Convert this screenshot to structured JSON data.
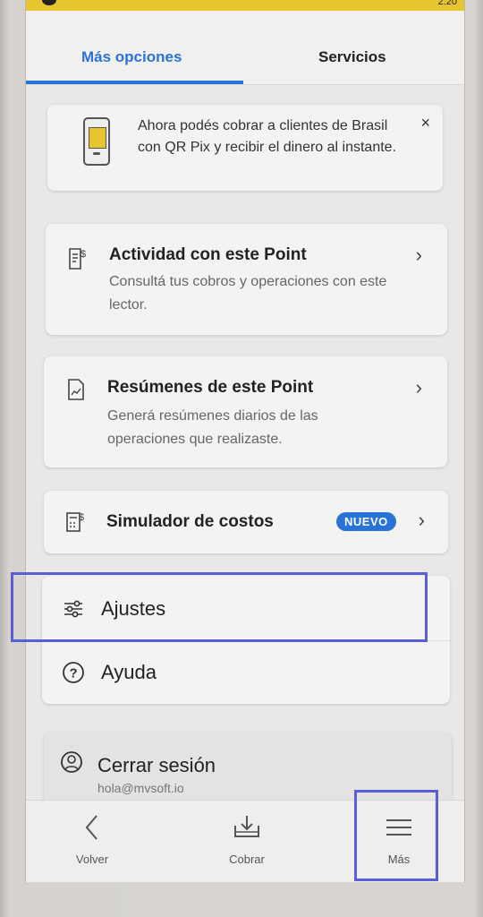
{
  "status_bar": {
    "time": "2:20"
  },
  "tabs": [
    {
      "label": "Más opciones",
      "active": true
    },
    {
      "label": "Servicios",
      "active": false
    }
  ],
  "banner": {
    "text": "Ahora podés cobrar a clientes de Brasil con QR Pix y recibir el dinero al instante.",
    "close": "×",
    "icon": "card-reader-icon"
  },
  "items": [
    {
      "title": "Actividad con este Point",
      "description": "Consultá tus cobros y operaciones con este lector.",
      "icon": "receipt-dollar-icon"
    },
    {
      "title": "Resúmenes de este Point",
      "description": "Generá resúmenes diarios de las operaciones que realizaste.",
      "icon": "document-chart-icon"
    },
    {
      "title": "Simulador de costos",
      "badge": "NUEVO",
      "icon": "calculator-dollar-icon"
    }
  ],
  "settings_group": [
    {
      "label": "Ajustes",
      "icon": "sliders-icon"
    },
    {
      "label": "Ayuda",
      "icon": "help-circle-icon"
    }
  ],
  "logout": {
    "label": "Cerrar sesión",
    "email": "hola@mvsoft.io",
    "icon": "user-circle-icon"
  },
  "bottom_nav": [
    {
      "label": "Volver",
      "icon": "chevron-left-icon"
    },
    {
      "label": "Cobrar",
      "icon": "download-tray-icon"
    },
    {
      "label": "Más",
      "icon": "menu-icon"
    }
  ],
  "colors": {
    "accent": "#2a73d6",
    "highlight": "#5b5fd6",
    "status_bar": "#e6c531"
  }
}
